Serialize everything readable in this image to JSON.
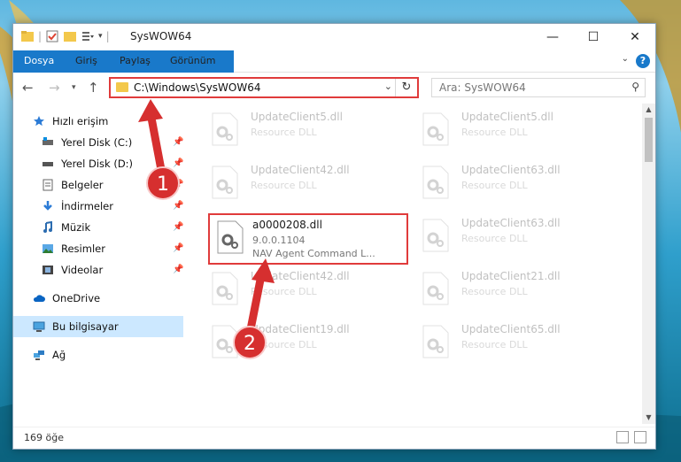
{
  "window": {
    "title": "SysWOW64",
    "controls": {
      "minimize": "—",
      "maximize": "☐",
      "close": "✕"
    }
  },
  "ribbon": {
    "tabs": [
      "Dosya",
      "Giriş",
      "Paylaş",
      "Görünüm"
    ],
    "help": "?",
    "file_tab_color": "#1979ca"
  },
  "navigation": {
    "back": "←",
    "forward": "→",
    "recent": "⌵",
    "up": "↑",
    "address_path": "C:\\Windows\\SysWOW64",
    "search_placeholder": "Ara: SysWOW64"
  },
  "sidebar": {
    "items": [
      {
        "label": "Hızlı erişim",
        "icon": "star-icon",
        "pinned": false
      },
      {
        "label": "Yerel Disk (C:)",
        "icon": "drive-icon",
        "pinned": true
      },
      {
        "label": "Yerel Disk (D:)",
        "icon": "drive-icon",
        "pinned": true
      },
      {
        "label": "Belgeler",
        "icon": "documents-icon",
        "pinned": true
      },
      {
        "label": "İndirmeler",
        "icon": "download-icon",
        "pinned": true
      },
      {
        "label": "Müzik",
        "icon": "music-icon",
        "pinned": true
      },
      {
        "label": "Resimler",
        "icon": "pictures-icon",
        "pinned": true
      },
      {
        "label": "Videolar",
        "icon": "videos-icon",
        "pinned": true
      },
      {
        "label": "OneDrive",
        "icon": "cloud-icon",
        "pinned": false
      },
      {
        "label": "Bu bilgisayar",
        "icon": "computer-icon",
        "pinned": false,
        "selected": true
      },
      {
        "label": "Ağ",
        "icon": "network-icon",
        "pinned": false
      }
    ]
  },
  "files": {
    "items": [
      {
        "name": "UpdateClient5.dll",
        "line1": "Resource DLL",
        "faded": true
      },
      {
        "name": "UpdateClient5.dll",
        "line1": "Resource DLL",
        "faded": true
      },
      {
        "name": "UpdateClient42.dll",
        "line1": "Resource DLL",
        "faded": true
      },
      {
        "name": "UpdateClient63.dll",
        "line1": "Resource DLL",
        "faded": true
      },
      {
        "name": "a0000208.dll",
        "line1": "9.0.0.1104",
        "line2": "NAV Agent Command L...",
        "faded": false,
        "highlighted": true
      },
      {
        "name": "UpdateClient63.dll",
        "line1": "Resource DLL",
        "faded": true
      },
      {
        "name": "UpdateClient42.dll",
        "line1": "Resource DLL",
        "faded": true
      },
      {
        "name": "UpdateClient21.dll",
        "line1": "Resource DLL",
        "faded": true
      },
      {
        "name": "UpdateClient19.dll",
        "line1": "Resource DLL",
        "faded": true
      },
      {
        "name": "UpdateClient65.dll",
        "line1": "Resource DLL",
        "faded": true
      }
    ]
  },
  "status": {
    "item_count": "169 öğe"
  },
  "annotations": {
    "step1": "1",
    "step2": "2",
    "color": "#d62f2f"
  }
}
